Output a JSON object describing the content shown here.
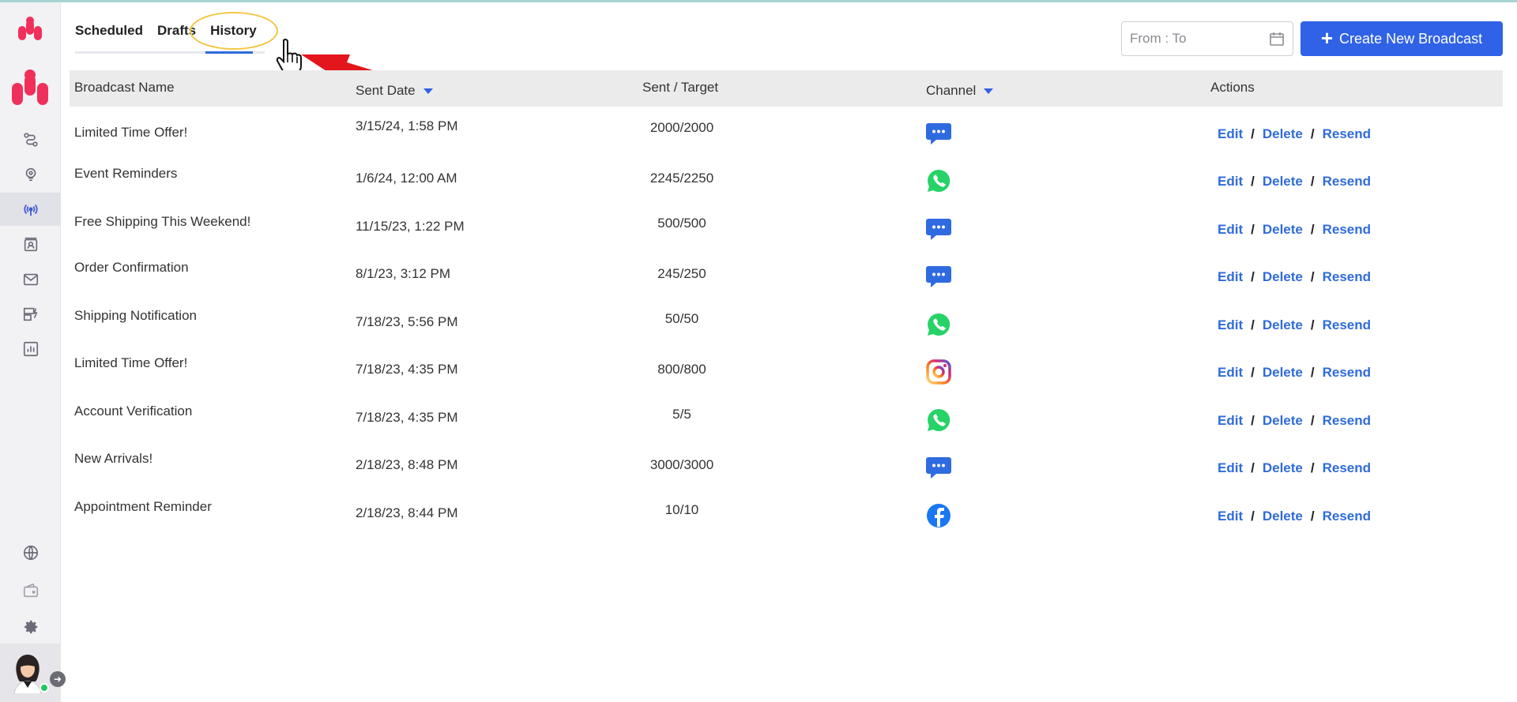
{
  "tabs": [
    {
      "label": "Scheduled"
    },
    {
      "label": "Drafts"
    },
    {
      "label": "History"
    }
  ],
  "active_tab": "History",
  "date_range": {
    "placeholder": "From : To"
  },
  "create_button": {
    "label": "Create New Broadcast"
  },
  "table": {
    "headers": {
      "name": "Broadcast Name",
      "date": "Sent Date",
      "sent": "Sent / Target",
      "channel": "Channel",
      "actions": "Actions"
    },
    "actions": {
      "edit": "Edit",
      "delete": "Delete",
      "resend": "Resend",
      "sep": "/"
    },
    "rows": [
      {
        "name": "Limited Time Offer!",
        "date": "3/15/24, 1:58 PM",
        "sent": "2000/2000",
        "channel": "sms"
      },
      {
        "name": "Event Reminders",
        "date": "1/6/24, 12:00 AM",
        "sent": "2245/2250",
        "channel": "whatsapp"
      },
      {
        "name": "Free Shipping This Weekend!",
        "date": "11/15/23, 1:22 PM",
        "sent": "500/500",
        "channel": "sms"
      },
      {
        "name": "Order Confirmation",
        "date": "8/1/23, 3:12 PM",
        "sent": "245/250",
        "channel": "sms"
      },
      {
        "name": "Shipping Notification",
        "date": "7/18/23, 5:56 PM",
        "sent": "50/50",
        "channel": "whatsapp"
      },
      {
        "name": "Limited Time Offer!",
        "date": "7/18/23, 4:35 PM",
        "sent": "800/800",
        "channel": "instagram"
      },
      {
        "name": "Account Verification",
        "date": "7/18/23, 4:35 PM",
        "sent": "5/5",
        "channel": "whatsapp"
      },
      {
        "name": "New Arrivals!",
        "date": "2/18/23, 8:48 PM",
        "sent": "3000/3000",
        "channel": "sms"
      },
      {
        "name": "Appointment Reminder",
        "date": "2/18/23, 8:44 PM",
        "sent": "10/10",
        "channel": "facebook"
      }
    ]
  },
  "sidebar": {
    "icons": [
      "flow-icon",
      "bulb-icon",
      "broadcast-icon",
      "contacts-icon",
      "mail-icon",
      "templates-icon",
      "analytics-icon",
      "globe-icon",
      "wallet-icon",
      "gear-icon"
    ]
  },
  "colors": {
    "accent": "#2f62e6",
    "brand": "#f0305a",
    "link": "#2f6bdb"
  }
}
